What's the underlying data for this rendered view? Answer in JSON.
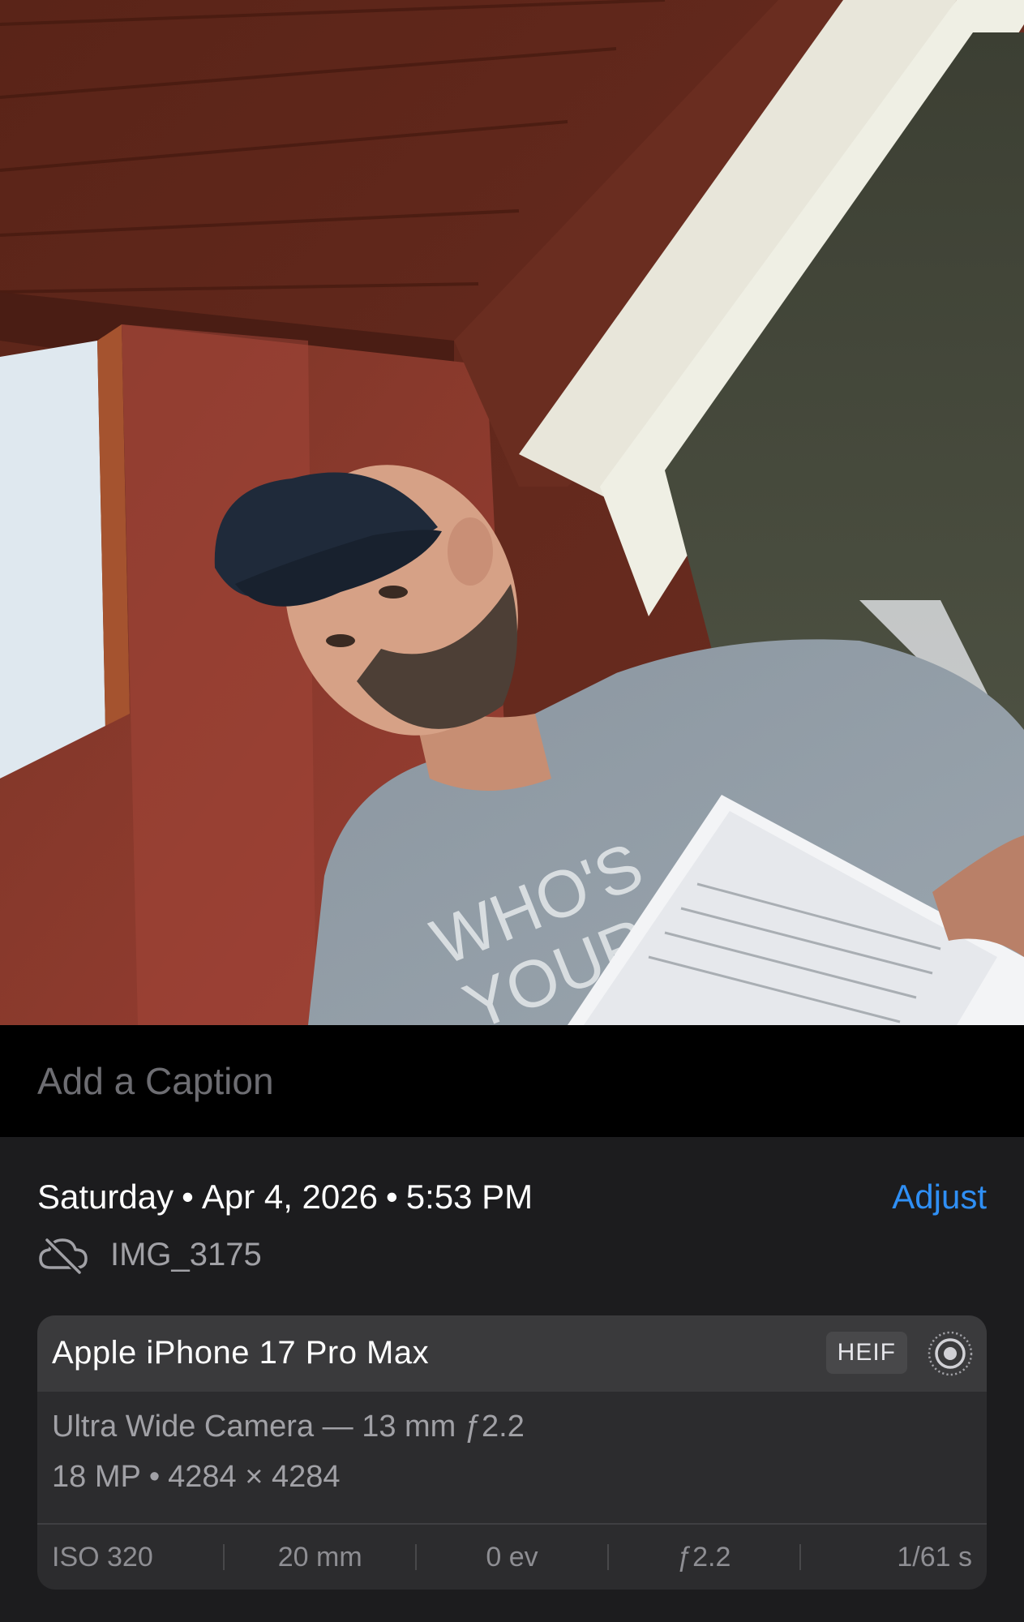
{
  "photo": {
    "shirt_line1": "WHO'S",
    "shirt_line2": "YOUR"
  },
  "caption": {
    "placeholder": "Add a Caption",
    "value": ""
  },
  "info": {
    "day": "Saturday",
    "date": "Apr 4, 2026",
    "time": "5:53 PM",
    "separator": "•",
    "adjust_label": "Adjust",
    "cloud_status_icon": "cloud-slash-icon",
    "file_name": "IMG_3175"
  },
  "device": {
    "name": "Apple iPhone 17 Pro Max",
    "format": "HEIF",
    "live_icon": "live-photo-icon",
    "lens": "Ultra Wide Camera — 13 mm ƒ2.2",
    "megapixels": "18 MP",
    "dimensions": "4284 × 4284",
    "exif": {
      "iso": "ISO 320",
      "focal": "20 mm",
      "ev": "0 ev",
      "aperture": "ƒ2.2",
      "shutter": "1/61 s"
    }
  },
  "colors": {
    "accent": "#2f8ff5",
    "sheet_bg": "#1c1c1e",
    "card_bg": "#2c2c2e",
    "card_head_bg": "#3a3a3c"
  }
}
